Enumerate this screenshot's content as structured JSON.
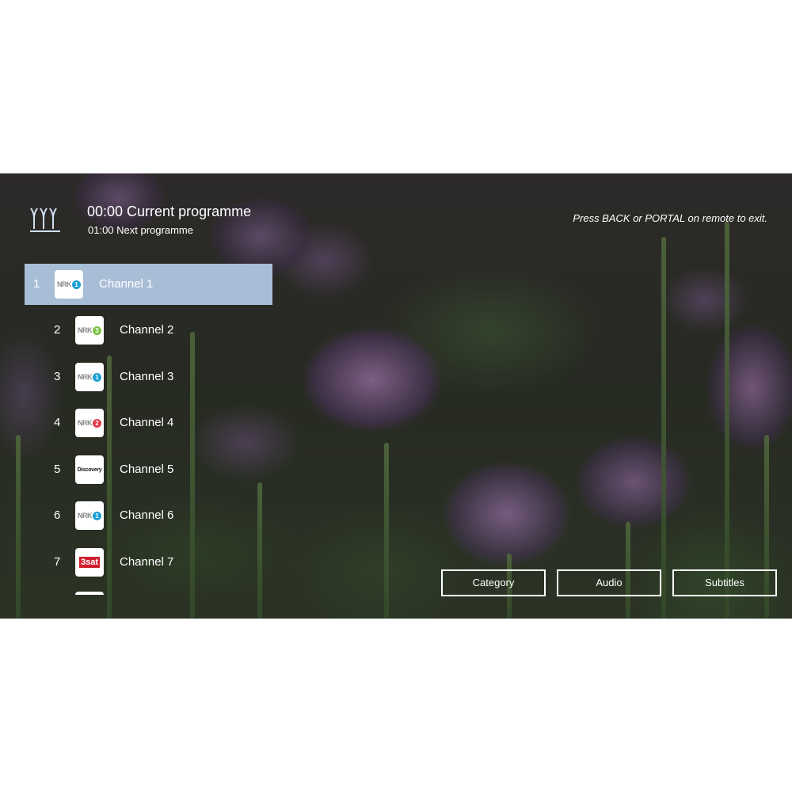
{
  "header": {
    "current_programme": "00:00 Current programme",
    "next_programme": "01:00 Next programme",
    "exit_hint": "Press BACK or PORTAL on remote to exit."
  },
  "channels": [
    {
      "number": "1",
      "name": "Channel 1",
      "logo": {
        "text": "NRK",
        "badge": "1",
        "badge_color": "#1a9fd6"
      },
      "selected": true
    },
    {
      "number": "2",
      "name": "Channel 2",
      "logo": {
        "text": "NRK",
        "badge": "3",
        "badge_color": "#7cc242"
      },
      "selected": false
    },
    {
      "number": "3",
      "name": "Channel 3",
      "logo": {
        "text": "NRK",
        "badge": "1",
        "badge_color": "#1a9fd6"
      },
      "selected": false
    },
    {
      "number": "4",
      "name": "Channel 4",
      "logo": {
        "text": "NRK",
        "badge": "2",
        "badge_color": "#e03a4a"
      },
      "selected": false
    },
    {
      "number": "5",
      "name": "Channel 5",
      "logo": {
        "text": "Discovery"
      },
      "selected": false
    },
    {
      "number": "6",
      "name": "Channel 6",
      "logo": {
        "text": "NRK",
        "badge": "1",
        "badge_color": "#1a9fd6"
      },
      "selected": false
    },
    {
      "number": "7",
      "name": "Channel 7",
      "logo": {
        "text": "3sat"
      },
      "selected": false
    }
  ],
  "buttons": {
    "category": "Category",
    "audio": "Audio",
    "subtitles": "Subtitles"
  },
  "colors": {
    "selected_row": "#a8bdd6",
    "text": "#ffffff"
  }
}
